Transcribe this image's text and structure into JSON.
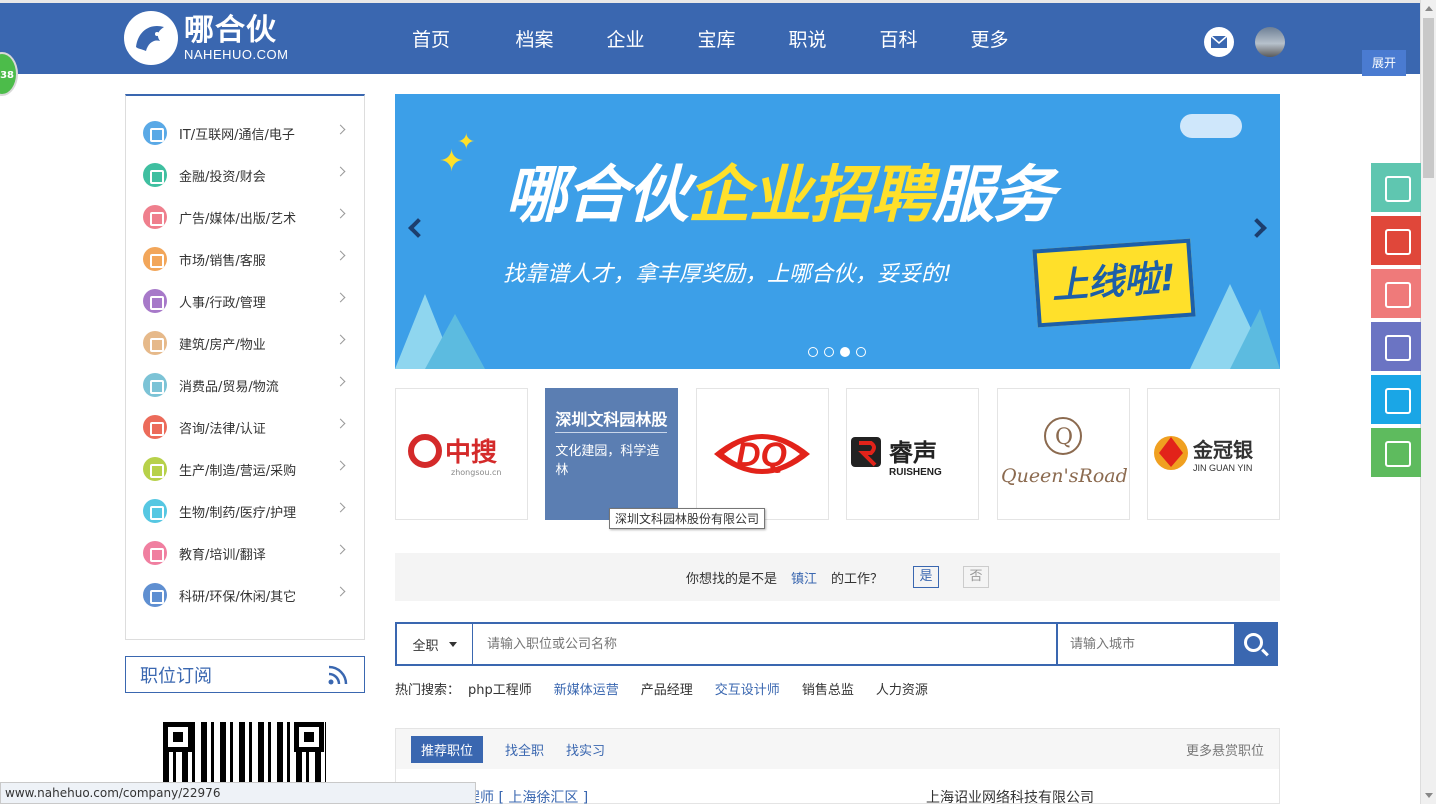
{
  "header": {
    "logo_cn": "哪合伙",
    "logo_en": "NAHEHUO.COM",
    "nav": [
      "首页",
      "档案",
      "企业",
      "宝库",
      "职说",
      "百科",
      "更多"
    ],
    "expand_label": "展开",
    "badge_count": "38"
  },
  "sidebar": {
    "categories": [
      {
        "label": "IT/互联网/通信/电子",
        "color": "#5aa9e6"
      },
      {
        "label": "金融/投资/财会",
        "color": "#3fbfa0"
      },
      {
        "label": "广告/媒体/出版/艺术",
        "color": "#ef7f8d"
      },
      {
        "label": "市场/销售/客服",
        "color": "#f2a65a"
      },
      {
        "label": "人事/行政/管理",
        "color": "#a779c9"
      },
      {
        "label": "建筑/房产/物业",
        "color": "#e6b98a"
      },
      {
        "label": "消费品/贸易/物流",
        "color": "#7cc3d6"
      },
      {
        "label": "咨询/法律/认证",
        "color": "#ec6b5a"
      },
      {
        "label": "生产/制造/营运/采购",
        "color": "#b7d14a"
      },
      {
        "label": "生物/制药/医疗/护理",
        "color": "#56c7e2"
      },
      {
        "label": "教育/培训/翻译",
        "color": "#f07fa0"
      },
      {
        "label": "科研/环保/休闲/其它",
        "color": "#5f8fd1"
      }
    ],
    "subscribe_label": "职位订阅"
  },
  "banner": {
    "title_a": "哪合伙",
    "title_b": "企业招聘",
    "title_c": "服务",
    "subtitle": "找靠谱人才，拿丰厚奖励，上哪合伙，妥妥的!",
    "badge": "上线啦!",
    "active_slide": 3,
    "slide_count": 4
  },
  "companies": [
    {
      "name": "中搜",
      "sub": "zhongsou.cn",
      "color": "#d42a2a"
    },
    {
      "name": "深圳文科园林股",
      "desc": "文化建园，科学造林",
      "tooltip": "深圳文科园林股份有限公司"
    },
    {
      "name": "DQ",
      "color": "#e2231a"
    },
    {
      "name": "睿声",
      "sub": "RUISHENG",
      "color": "#222222"
    },
    {
      "name": "Queen'sRoad",
      "color": "#8b6a4f"
    },
    {
      "name": "金冠银",
      "sub": "JIN GUAN YIN",
      "color": "#333333"
    }
  ],
  "ask": {
    "prefix": "你想找的是不是",
    "city": "镇江",
    "suffix": "的工作？",
    "yes": "是",
    "no": "否"
  },
  "search": {
    "type": "全职",
    "placeholder": "请输入职位或公司名称",
    "city_placeholder": "请输入城市"
  },
  "hot": {
    "label": "热门搜索：",
    "tags": [
      "php工程师",
      "新媒体运营",
      "产品经理",
      "交互设计师",
      "销售总监",
      "人力资源"
    ]
  },
  "jobs": {
    "tabs": [
      "推荐职位",
      "找全职",
      "找实习"
    ],
    "more": "更多悬赏职位",
    "row_title": "程师 [ 上海徐汇区 ]",
    "row_company": "上海诏业网络科技有限公司"
  },
  "status_url": "www.nahehuo.com/company/22976",
  "side_tools": [
    {
      "name": "resume-tool",
      "color": "#5fc6b0"
    },
    {
      "name": "favorite-tool",
      "color": "#e0473a"
    },
    {
      "name": "rss-tool",
      "color": "#ef7a7a"
    },
    {
      "name": "message-tool",
      "color": "#6b74c3"
    },
    {
      "name": "qq-tool",
      "color": "#1aa6e6"
    },
    {
      "name": "chat-tool",
      "color": "#5ebb5e"
    }
  ]
}
